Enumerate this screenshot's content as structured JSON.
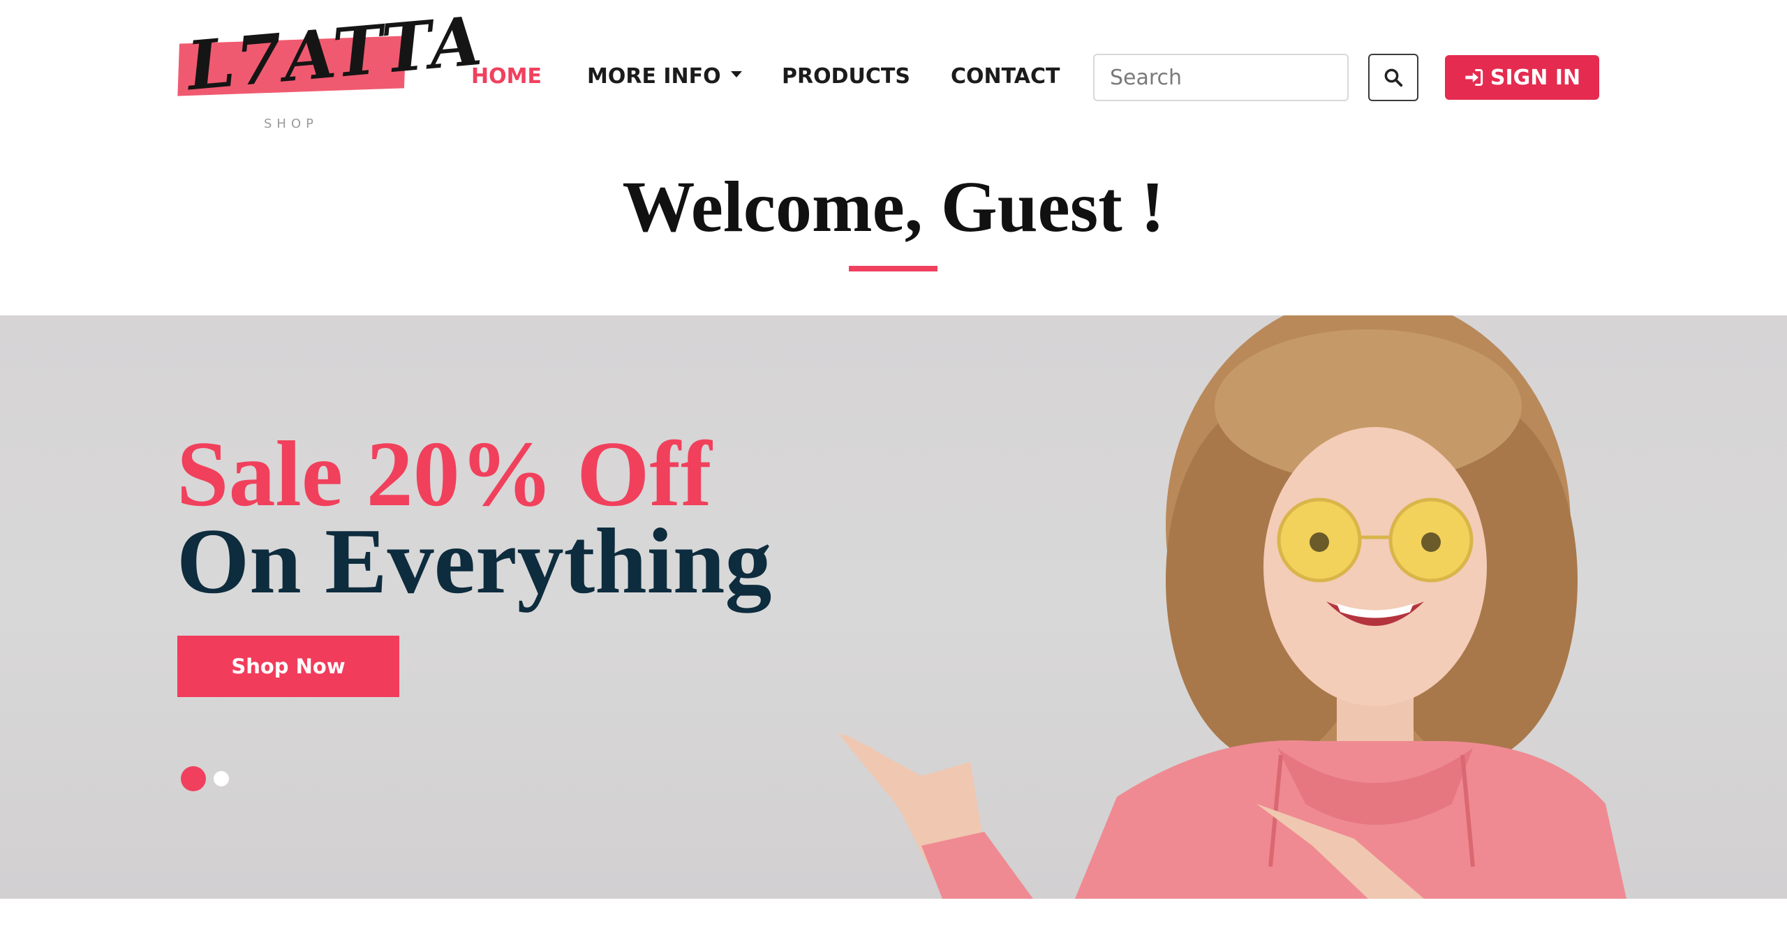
{
  "brand": {
    "logo_text": "L7ATTA",
    "logo_sub": "SHOP",
    "accent_color": "#f0405e",
    "dark_color": "#0d2c3e"
  },
  "nav": {
    "items": [
      {
        "label": "HOME",
        "active": true
      },
      {
        "label": "MORE INFO",
        "dropdown": true
      },
      {
        "label": "PRODUCTS"
      },
      {
        "label": "CONTACT"
      }
    ],
    "search_placeholder": "Search",
    "search_icon": "search-icon",
    "signin_label": "SIGN IN",
    "signin_icon": "sign-in-icon"
  },
  "welcome": {
    "title": "Welcome, Guest !"
  },
  "hero": {
    "line1": "Sale 20% Off",
    "line2": "On Everything",
    "cta_label": "Shop Now",
    "slides_total": 2,
    "active_slide": 1
  }
}
